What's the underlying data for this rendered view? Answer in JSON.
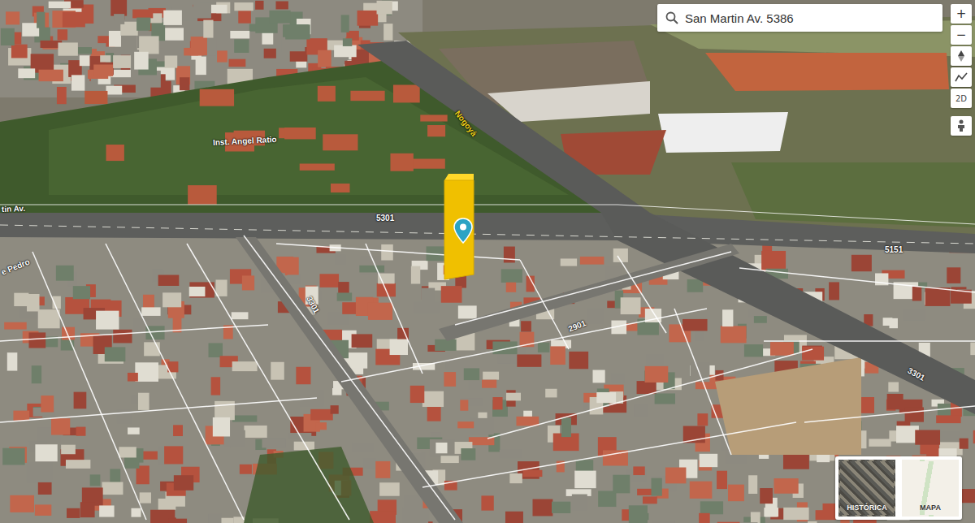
{
  "search": {
    "value": "San Martin Av. 5386"
  },
  "zoom_controls": [
    {
      "label": "+"
    },
    {
      "label": "−"
    }
  ],
  "view_mode": {
    "label": "2D"
  },
  "map_labels": [
    {
      "text": "tin Av.",
      "kind": "street"
    },
    {
      "text": "Inst. Angel Ratio",
      "kind": "place"
    },
    {
      "text": "Nogoyá",
      "kind": "road"
    },
    {
      "text": "5301",
      "kind": "number"
    },
    {
      "text": "5151",
      "kind": "number"
    },
    {
      "text": "3301",
      "kind": "number"
    },
    {
      "text": "2901",
      "kind": "number"
    },
    {
      "text": "3301",
      "kind": "number"
    },
    {
      "text": "e Pedro",
      "kind": "street"
    }
  ],
  "base_layers": [
    {
      "label": "HISTÓRICA",
      "selected": false
    },
    {
      "label": "MAPA",
      "selected": false
    }
  ]
}
